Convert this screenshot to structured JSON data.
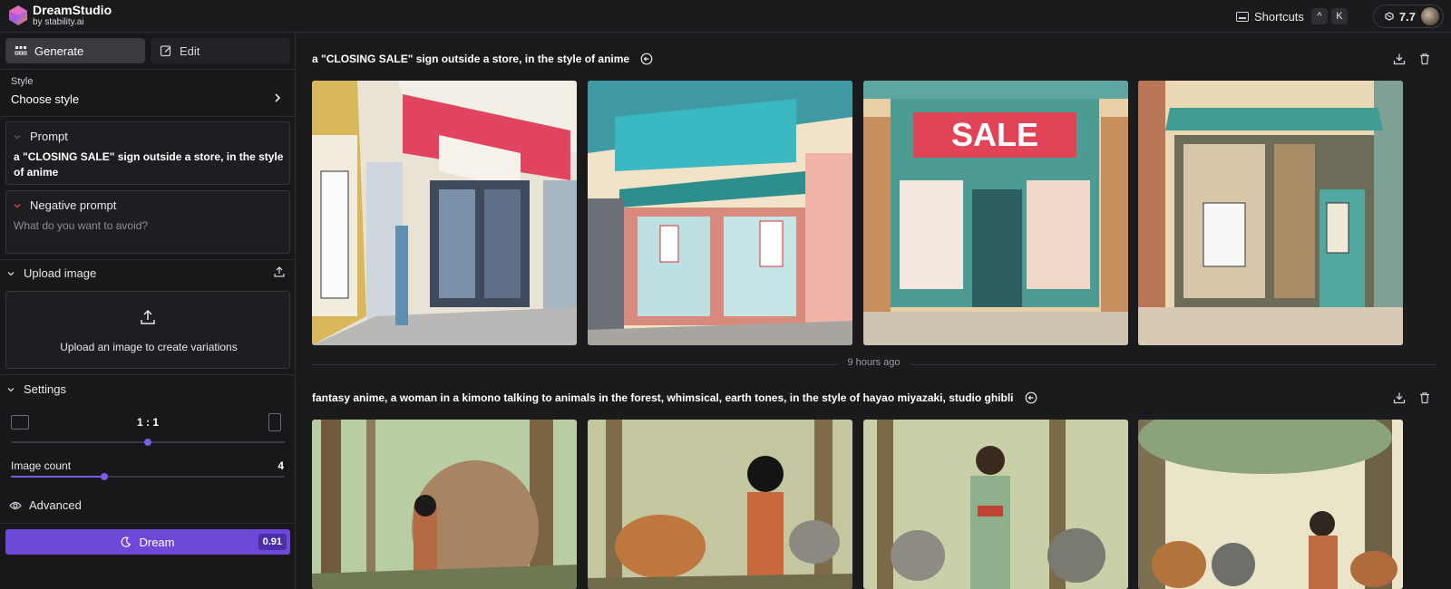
{
  "app": {
    "name": "DreamStudio",
    "sub": "by stability.ai",
    "shortcuts_label": "Shortcuts",
    "keys": [
      "^",
      "K"
    ],
    "credits": "7.7"
  },
  "sidebar": {
    "tabs": [
      {
        "label": "Generate",
        "icon": "grid-icon"
      },
      {
        "label": "Edit",
        "icon": "edit-icon"
      }
    ],
    "style": {
      "label": "Style",
      "value": "Choose style"
    },
    "prompt": {
      "label": "Prompt",
      "text": "a \"CLOSING SALE\" sign outside a store, in the style of anime"
    },
    "negative_prompt": {
      "label": "Negative prompt",
      "placeholder": "What do you want to avoid?"
    },
    "upload": {
      "label": "Upload image",
      "hint": "Upload an image to create variations"
    },
    "settings": {
      "label": "Settings",
      "aspect_ratio": "1 : 1",
      "aspect_position": 0.5,
      "image_count_label": "Image count",
      "image_count": "4",
      "image_count_fraction": 0.34
    },
    "advanced_label": "Advanced",
    "dream": {
      "label": "Dream",
      "cost": "0.91"
    }
  },
  "main": {
    "generations": [
      {
        "prompt": "a \"CLOSING SALE\" sign outside a store, in the style of anime",
        "images": [
          "store-anime-1",
          "store-anime-2",
          "store-anime-3",
          "store-anime-4"
        ]
      },
      {
        "prompt": "fantasy anime, a woman in a kimono talking to animals in the forest, whimsical, earth tones, in the style of hayao miyazaki, studio ghibli",
        "images": [
          "forest-anime-1",
          "forest-anime-2",
          "forest-anime-3",
          "forest-anime-4"
        ]
      }
    ],
    "separator_time": "9 hours ago"
  },
  "colors": {
    "accent": "#6e48d8",
    "background": "#1b1b1e"
  }
}
